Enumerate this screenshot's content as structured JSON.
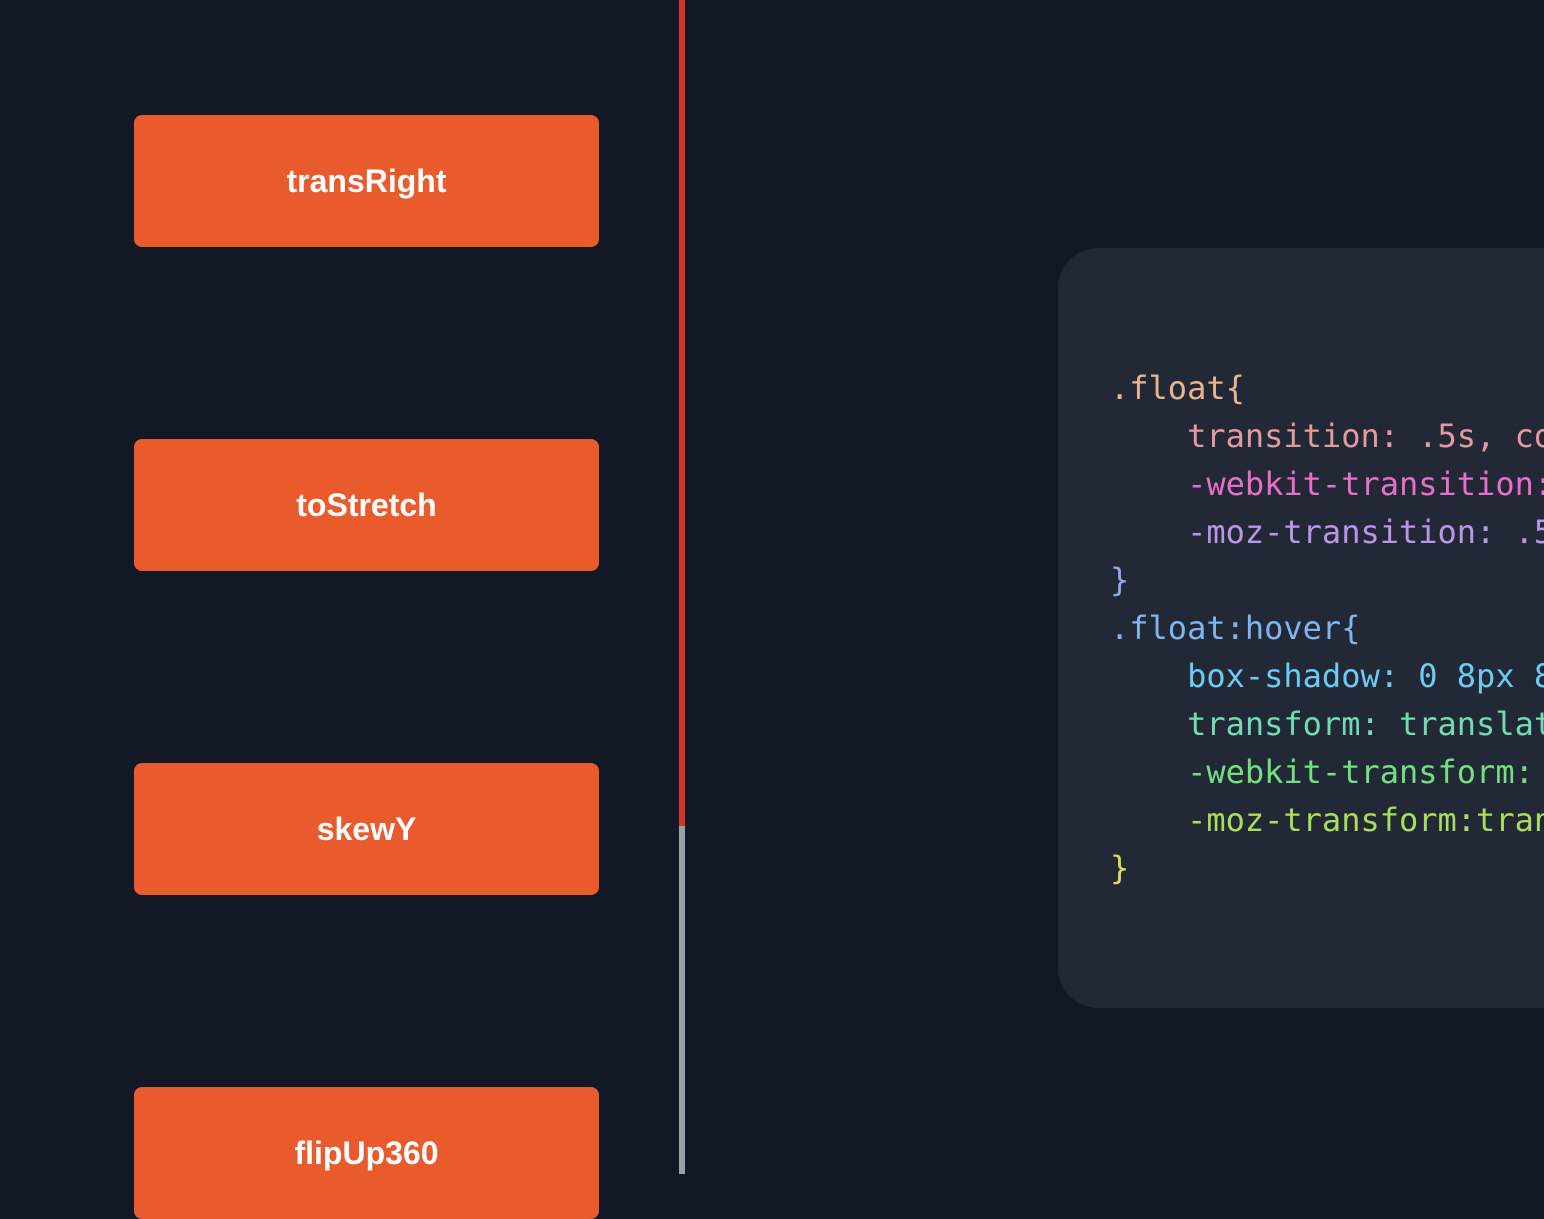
{
  "buttons": [
    {
      "label": "transRight"
    },
    {
      "label": "toStretch"
    },
    {
      "label": "skewY"
    },
    {
      "label": "flipUp360"
    }
  ],
  "code": {
    "lines": [
      {
        "text": ".float{",
        "color": "#e8b58a"
      },
      {
        "text": "    transition: .5s, co",
        "color": "#e39ba0"
      },
      {
        "text": "    -webkit-transition:",
        "color": "#e86fc8"
      },
      {
        "text": "    -moz-transition: .5",
        "color": "#b996e6"
      },
      {
        "text": "}",
        "color": "#8fa8e8"
      },
      {
        "text": ".float:hover{",
        "color": "#7fb4ec"
      },
      {
        "text": "    box-shadow: 0 8px 8",
        "color": "#6ccbf0"
      },
      {
        "text": "    transform: translat",
        "color": "#6fdcb2"
      },
      {
        "text": "    -webkit-transform:",
        "color": "#72e07e"
      },
      {
        "text": "    -moz-transform:tran",
        "color": "#a8df5a"
      },
      {
        "text": "}",
        "color": "#d8dc58"
      }
    ]
  },
  "colors": {
    "background": "#131826",
    "button": "#e95a2c",
    "button_text": "#ffffff",
    "code_panel": "#222836",
    "divider_active": "#d93125",
    "divider_rest": "#9aa0a8"
  }
}
